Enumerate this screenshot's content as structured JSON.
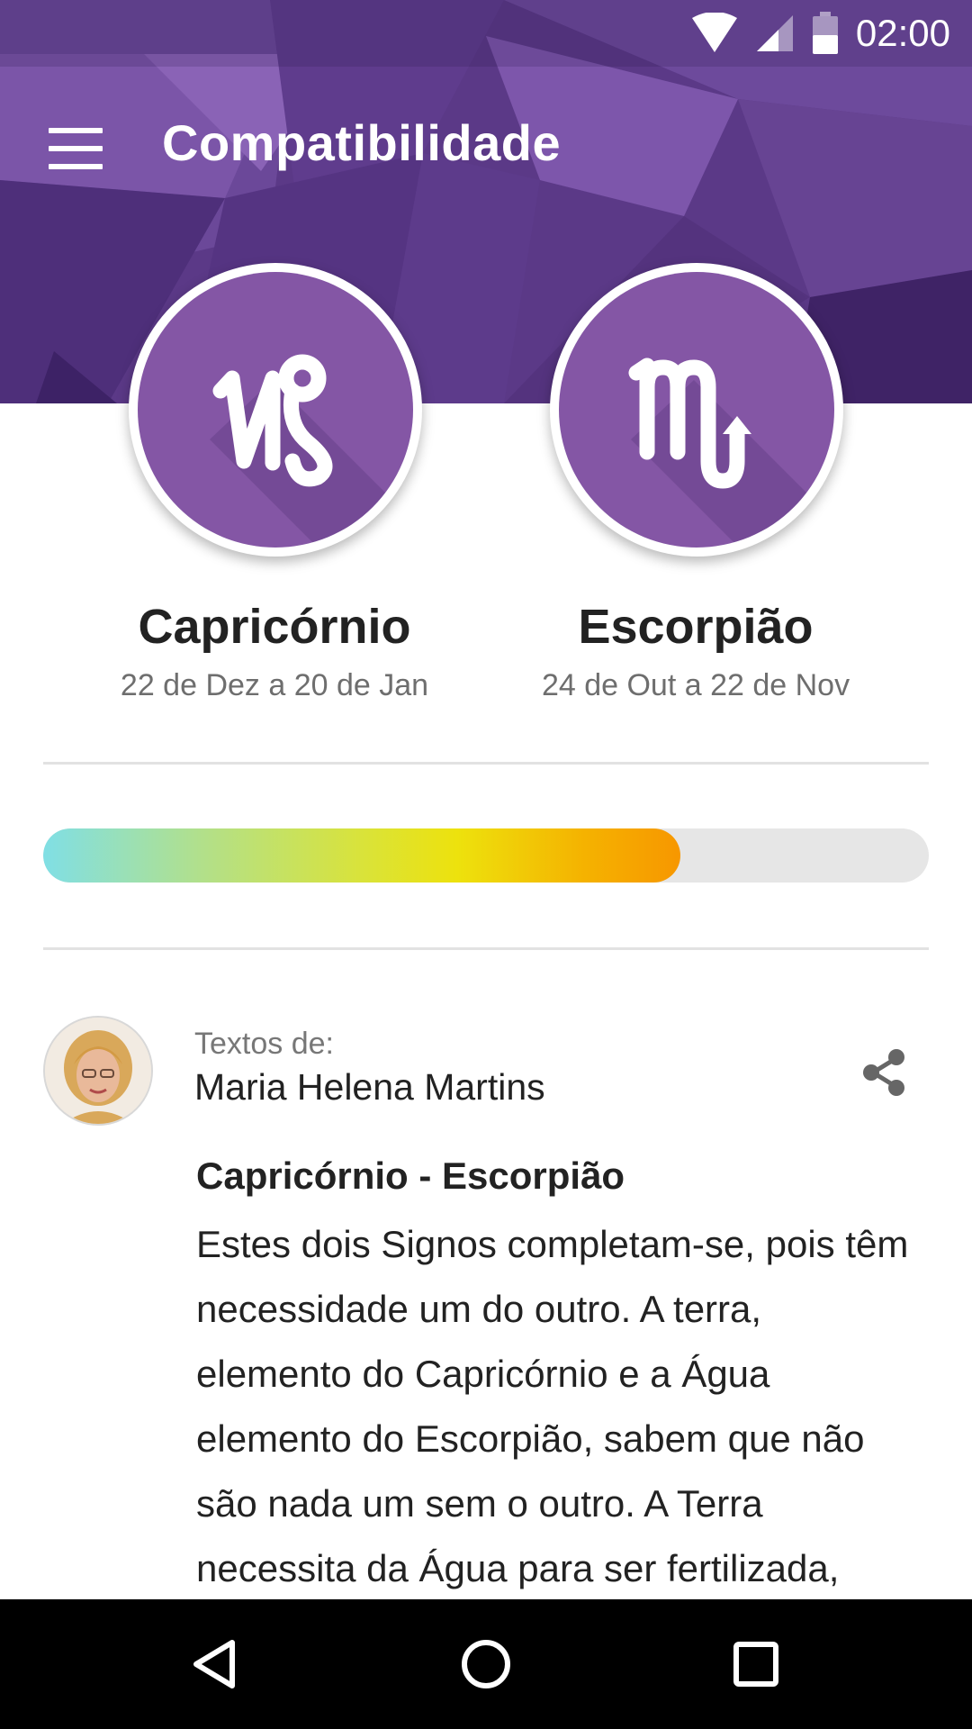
{
  "status_bar": {
    "time": "02:00",
    "icons": [
      "wifi-icon",
      "signal-icon",
      "battery-icon"
    ]
  },
  "app_bar": {
    "title": "Compatibilidade",
    "menu_icon": "hamburger-menu-icon"
  },
  "signs": [
    {
      "name": "Capricórnio",
      "dates": "22 de Dez a 20 de Jan",
      "icon": "capricorn-icon"
    },
    {
      "name": "Escorpião",
      "dates": "24 de Out a 22 de Nov",
      "icon": "scorpio-icon"
    }
  ],
  "compatibility": {
    "level": 0.72
  },
  "author": {
    "label": "Textos de:",
    "name": "Maria Helena Martins",
    "share_icon": "share-icon"
  },
  "article": {
    "title": "Capricórnio - Escorpião",
    "body": "Estes dois Signos completam-se, pois têm necessidade um do outro. A terra, elemento do Capricórnio e a Água elemento do Escorpião, sabem que não são nada um sem o outro. A Terra necessita da Água para ser fertilizada,"
  },
  "colors": {
    "primary": "#5a3885",
    "sign_circle": "#8456a5",
    "bar_start": "#80dfe5",
    "bar_end": "#f79700"
  },
  "nav_bar": {
    "icons": [
      "back-icon",
      "home-icon",
      "recents-icon"
    ]
  }
}
